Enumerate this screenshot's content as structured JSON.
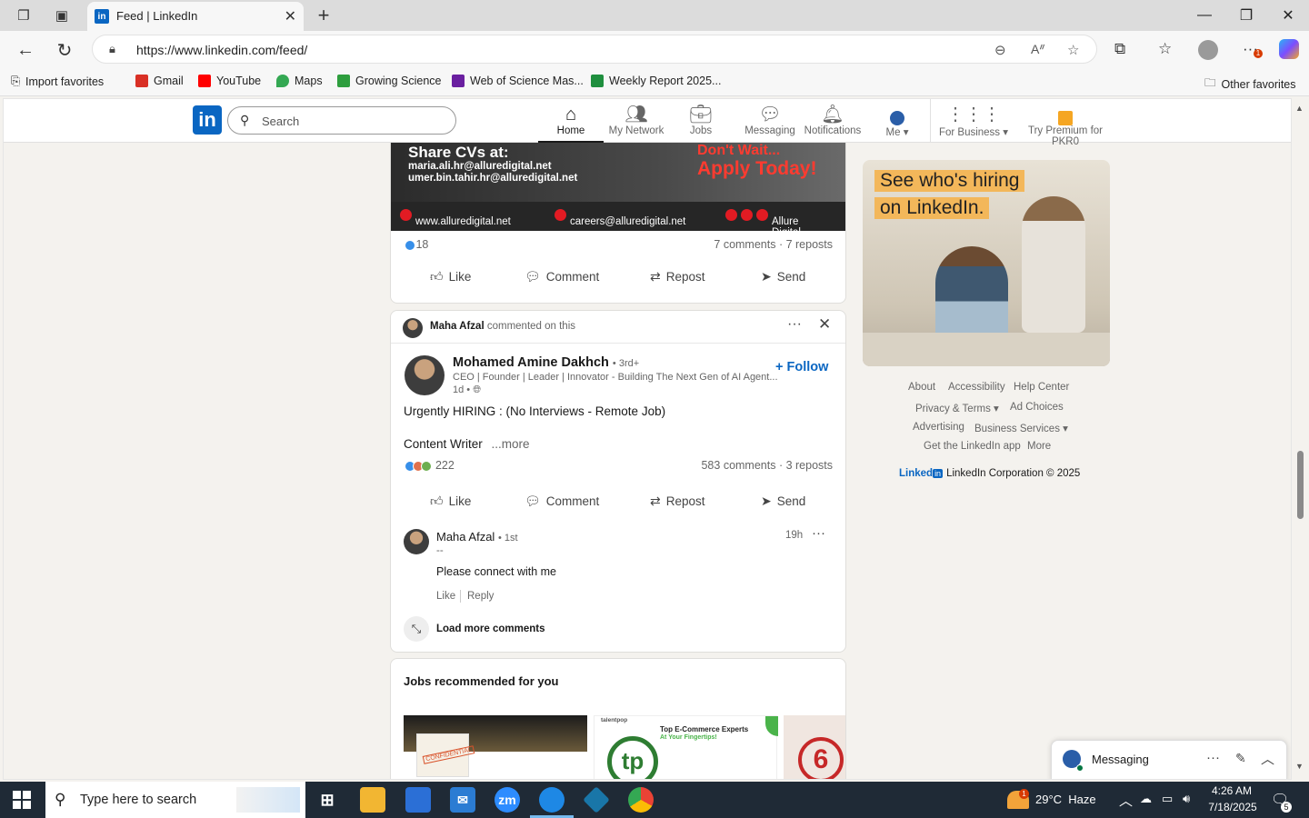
{
  "browser": {
    "tab_title": "Feed | LinkedIn",
    "url": "https://www.linkedin.com/feed/",
    "favorites": [
      {
        "label": "Import favorites",
        "color": "#555555"
      },
      {
        "label": "Gmail",
        "color": "#d93025"
      },
      {
        "label": "YouTube",
        "color": "#ff0000"
      },
      {
        "label": "Maps",
        "color": "#34a853"
      },
      {
        "label": "Growing Science",
        "color": "#2e9e3e"
      },
      {
        "label": "Web of Science Mas...",
        "color": "#6a1fa0"
      },
      {
        "label": "Weekly Report 2025...",
        "color": "#1f8f3e"
      }
    ],
    "other_favorites": "Other favorites",
    "extension_badge": "1"
  },
  "linkedin": {
    "search_placeholder": "Search",
    "nav": [
      {
        "label": "Home",
        "icon": "home-icon",
        "active": true
      },
      {
        "label": "My Network",
        "icon": "network-icon"
      },
      {
        "label": "Jobs",
        "icon": "briefcase-icon"
      },
      {
        "label": "Messaging",
        "icon": "chat-icon"
      },
      {
        "label": "Notifications",
        "icon": "bell-icon"
      },
      {
        "label": "Me",
        "icon": "avatar-icon"
      },
      {
        "label": "For Business",
        "icon": "grid-icon"
      },
      {
        "label": "Try Premium for PKR0",
        "icon": "premium-icon"
      }
    ]
  },
  "post1": {
    "banner_title": "Share CVs at:",
    "email1": "maria.ali.hr@alluredigital.net",
    "email2": "umer.bin.tahir.hr@alluredigital.net",
    "wait": "Don't Wait...",
    "apply": "Apply Today!",
    "website": "www.alluredigital.net",
    "careers": "careers@alluredigital.net",
    "brand": "Allure Digital",
    "reactions": "18",
    "stats": "7 comments · 7 reposts"
  },
  "actions": {
    "like": "Like",
    "comment": "Comment",
    "repost": "Repost",
    "send": "Send"
  },
  "post2": {
    "commenter": "Maha Afzal",
    "commented": "commented on this",
    "author": "Mohamed Amine Dakhch",
    "degree": "• 3rd+",
    "headline": "CEO | Founder | Leader | Innovator - Building The Next Gen of AI Agent...",
    "time": "1d •",
    "follow": "Follow",
    "line1": "Urgently HIRING : (No Interviews - Remote Job)",
    "line2": "Content Writer",
    "more": "...more",
    "reactions": "222",
    "stats": "583 comments · 3 reposts",
    "comment": {
      "name": "Maha Afzal",
      "degree": "• 1st",
      "dash": "--",
      "time": "19h",
      "text": "Please connect with me",
      "like": "Like",
      "reply": "Reply"
    },
    "load_more": "Load more comments"
  },
  "jobs": {
    "title": "Jobs recommended for you",
    "card2_top": "Top E-Commerce Experts",
    "card2_sub": "At Your Fingertips!",
    "card2_brand": "talentpop",
    "card2_logo": "tp",
    "card1_stamp": "CONFIDENTIAL"
  },
  "sidebar": {
    "ad_line1": "See who's hiring",
    "ad_line2": "on LinkedIn.",
    "links": [
      "About",
      "Accessibility",
      "Help Center",
      "Privacy & Terms",
      "Ad Choices",
      "Advertising",
      "Business Services",
      "Get the LinkedIn app",
      "More"
    ],
    "copyright": "LinkedIn Corporation © 2025",
    "brand": "Linked"
  },
  "messaging": {
    "label": "Messaging"
  },
  "taskbar": {
    "search_placeholder": "Type here to search",
    "weather_temp": "29°C",
    "weather_desc": "Haze",
    "weather_badge": "1",
    "time": "4:26 AM",
    "date": "7/18/2025",
    "notif_count": "5"
  }
}
